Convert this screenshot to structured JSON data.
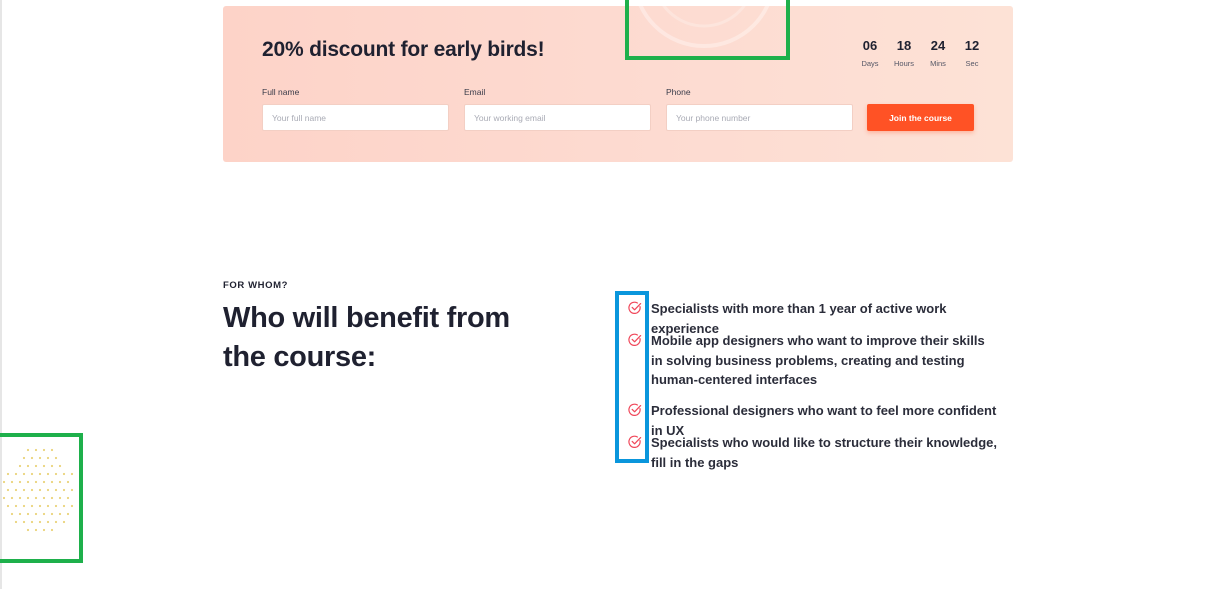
{
  "promo": {
    "title": "20% discount for early birds!",
    "countdown": [
      {
        "value": "06",
        "label": "Days"
      },
      {
        "value": "18",
        "label": "Hours"
      },
      {
        "value": "24",
        "label": "Mins"
      },
      {
        "value": "12",
        "label": "Sec"
      }
    ],
    "fields": [
      {
        "label": "Full name",
        "placeholder": "Your full name"
      },
      {
        "label": "Email",
        "placeholder": "Your working email"
      },
      {
        "label": "Phone",
        "placeholder": "Your phone number"
      }
    ],
    "submit_label": "Join the course",
    "colors": {
      "card_bg": "#fdd8cd",
      "accent": "#ff5225"
    }
  },
  "audience": {
    "eyebrow": "FOR WHOM?",
    "title": "Who will benefit from the course:",
    "items": [
      {
        "icon": "check-circle-icon",
        "text": "Specialists with more than 1 year of active work experience"
      },
      {
        "icon": "check-circle-icon",
        "text": "Mobile app designers who want to improve their skills in solving business problems, creating and testing human-centered interfaces"
      },
      {
        "icon": "check-circle-icon",
        "text": "Professional designers who want to feel more confident in UX"
      },
      {
        "icon": "check-circle-icon",
        "text": "Specialists who would like to structure their knowledge, fill in the gaps"
      }
    ],
    "colors": {
      "check": "#f0475a",
      "text": "#2b2d3a"
    }
  },
  "highlights": {
    "green": "#1eb04b",
    "blue": "#0a96dc"
  }
}
